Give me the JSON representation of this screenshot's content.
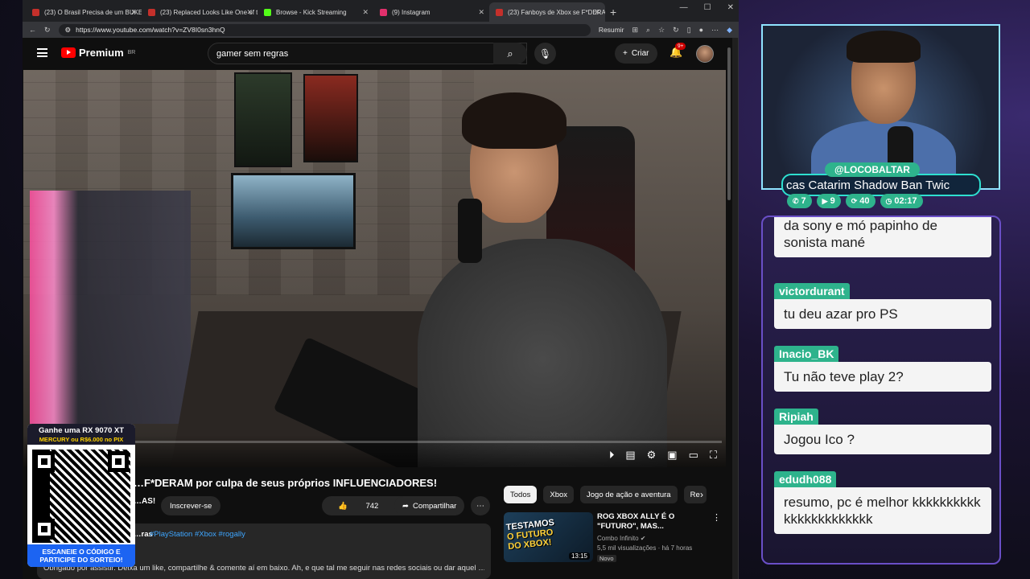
{
  "browser": {
    "tabs": [
      {
        "label": "(23) O Brasil Precisa de um BUKE…",
        "fav": "#c4302b",
        "active": false
      },
      {
        "label": "(23) Replaced Looks Like One of t…",
        "fav": "#c4302b",
        "active": false
      },
      {
        "label": "Browse - Kick Streaming",
        "fav": "#53fc18",
        "active": false
      },
      {
        "label": "(9) Instagram",
        "fav": "#e1306c",
        "active": false
      },
      {
        "label": "(23) Fanboys de Xbox se F*DERAM",
        "fav": "#c4302b",
        "active": true
      }
    ],
    "url": "https://www.youtube.com/watch?v=ZV8I0sn3hnQ",
    "resumir": "Resumir"
  },
  "youtube": {
    "logo": "Premium",
    "region": "BR",
    "search_value": "gamer sem regras",
    "create_label": "Criar",
    "notif_badge": "9+",
    "video_title": "…F*DERAM por culpa de seus próprios INFLUENCIADORES!",
    "channel_partial": "…AS!",
    "subscribe_label": "Inscrever-se",
    "likes": "742",
    "share_label": "Compartilhar",
    "desc_author": "…ras",
    "desc_tags": "#PlayStation #Xbox #rogally",
    "desc_text": "Obrigado por assistir. Deixa um like, compartilhe & comente aí em baixo. Ah, e que tal me seguir nas redes sociais ou dar aquel …mais",
    "chips": [
      "Todos",
      "Xbox",
      "Jogo de ação e aventura",
      "Re"
    ],
    "rec": {
      "title": "ROG XBOX ALLY É O \"FUTURO\", MAS...",
      "channel": "Combo Infinito ✔",
      "meta": "5,5 mil visualizações · há 7 horas",
      "badge": "Novo",
      "duration": "13:15",
      "thumb_line1": "TESTAMOS",
      "thumb_line2": "O FUTURO",
      "thumb_line3": "DO XBOX!"
    }
  },
  "qr_promo": {
    "headline": "Ganhe uma RX 9070 XT",
    "sub": "MERCURY ou R$6.000 no PIX",
    "footer1": "ESCANEIE O CÓDIGO E",
    "footer2": "PARTICIPE DO SORTEIO!"
  },
  "stream": {
    "handle": "@LOCOBALTAR",
    "ticker": "cas Catarim Shadow Ban Twic",
    "stats": [
      {
        "icon": "phone-icon",
        "value": "7"
      },
      {
        "icon": "play-icon",
        "value": "9"
      },
      {
        "icon": "refresh-icon",
        "value": "40"
      },
      {
        "icon": "clock-icon",
        "value": "02:17"
      }
    ]
  },
  "chat": [
    {
      "user": "",
      "text": "da sony e mó papinho de sonista mané"
    },
    {
      "user": "victordurant",
      "text": "tu deu azar pro PS"
    },
    {
      "user": "Inacio_BK",
      "text": "Tu não teve play 2?"
    },
    {
      "user": "Ripiah",
      "text": "Jogou Ico ?"
    },
    {
      "user": "edudh088",
      "text": "resumo, pc é melhor kkkkkkkkkkkkkkkkkkkkkkk"
    }
  ]
}
